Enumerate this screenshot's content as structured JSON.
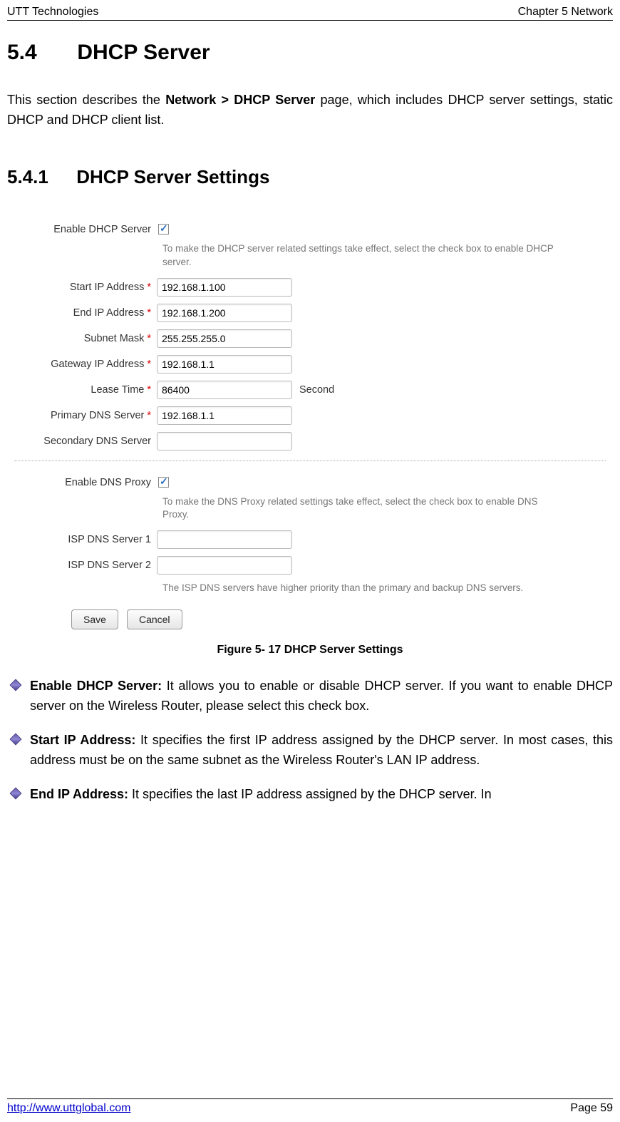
{
  "header": {
    "left": "UTT Technologies",
    "right": "Chapter 5 Network"
  },
  "section": {
    "number": "5.4",
    "title": "DHCP Server"
  },
  "intro": {
    "pre": "This section describes the ",
    "bold": "Network > DHCP Server",
    "post": " page, which includes DHCP server settings, static DHCP and DHCP client list."
  },
  "subsection": {
    "number": "5.4.1",
    "title": "DHCP Server Settings"
  },
  "form": {
    "enable_dhcp_label": "Enable DHCP Server",
    "enable_dhcp_help": "To make the DHCP server related settings take effect, select the check box to enable DHCP server.",
    "start_ip_label": "Start IP Address",
    "start_ip_value": "192.168.1.100",
    "end_ip_label": "End IP Address",
    "end_ip_value": "192.168.1.200",
    "subnet_label": "Subnet Mask",
    "subnet_value": "255.255.255.0",
    "gateway_label": "Gateway IP Address",
    "gateway_value": "192.168.1.1",
    "lease_label": "Lease Time",
    "lease_value": "86400",
    "lease_unit": "Second",
    "primary_dns_label": "Primary DNS Server",
    "primary_dns_value": "192.168.1.1",
    "secondary_dns_label": "Secondary DNS Server",
    "secondary_dns_value": "",
    "enable_dns_proxy_label": "Enable DNS Proxy",
    "enable_dns_proxy_help": "To make the DNS Proxy related settings take effect, select the check box to enable DNS Proxy.",
    "isp_dns1_label": "ISP DNS Server 1",
    "isp_dns1_value": "",
    "isp_dns2_label": "ISP DNS Server 2",
    "isp_dns2_value": "",
    "isp_note": "The ISP DNS servers have higher priority than the primary and backup DNS servers.",
    "save_label": "Save",
    "cancel_label": "Cancel",
    "required_mark": "*"
  },
  "figure_caption": "Figure 5- 17 DHCP Server Settings",
  "bullets": [
    {
      "bold": "Enable DHCP Server:",
      "text": " It allows you to enable or disable DHCP server. If you want to enable DHCP server on the Wireless Router, please select this check box."
    },
    {
      "bold": "Start IP Address:",
      "text": " It specifies the first IP address assigned by the DHCP server. In most cases, this address must be on the same subnet as the Wireless Router's LAN IP address."
    },
    {
      "bold": "End IP Address:",
      "text": " It specifies the last IP address assigned by the DHCP server. In"
    }
  ],
  "footer": {
    "link": "http://www.uttglobal.com",
    "page": "Page 59"
  }
}
